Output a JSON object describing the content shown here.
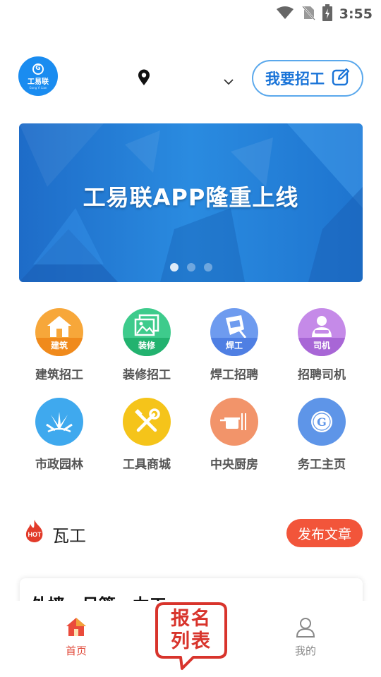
{
  "status_bar": {
    "time": "3:55"
  },
  "header": {
    "logo_text": "工易联",
    "logo_sub": "Gong Yi Lian",
    "recruit_label": "我要招工"
  },
  "banner": {
    "title": "工易联APP隆重上线",
    "slides": 3,
    "active_slide": 1
  },
  "categories": [
    {
      "label": "建筑招工",
      "badge": "建筑",
      "color": "#f7a73a",
      "badge_color": "#f08a1c",
      "icon": "house-icon"
    },
    {
      "label": "装修招工",
      "badge": "装修",
      "color": "#3ecb8c",
      "badge_color": "#22b26f",
      "icon": "pictures-icon"
    },
    {
      "label": "焊工招聘",
      "badge": "焊工",
      "color": "#6e9bef",
      "badge_color": "#4f7fe3",
      "icon": "welding-mask-icon"
    },
    {
      "label": "招聘司机",
      "badge": "司机",
      "color": "#c58ae8",
      "badge_color": "#a866d6",
      "icon": "driver-icon"
    },
    {
      "label": "市政园林",
      "badge": "",
      "color": "#3fa9ee",
      "badge_color": "",
      "icon": "plant-icon"
    },
    {
      "label": "工具商城",
      "badge": "",
      "color": "#f5c41a",
      "badge_color": "",
      "icon": "tools-icon"
    },
    {
      "label": "中央厨房",
      "badge": "",
      "color": "#f2946a",
      "badge_color": "",
      "icon": "pot-icon"
    },
    {
      "label": "务工主页",
      "badge": "",
      "color": "#5e95e8",
      "badge_color": "",
      "icon": "g-logo-icon"
    }
  ],
  "section": {
    "hot_label": "HOT",
    "title": "瓦工",
    "publish_label": "发布文章"
  },
  "article": {
    "title": "外墙、吊篮、力工"
  },
  "bottom_nav": {
    "home_label": "首页",
    "signup_label_line1": "报名",
    "signup_label_line2": "列表",
    "me_label": "我的"
  },
  "colors": {
    "accent_blue": "#1a74d8",
    "accent_red": "#f2553a",
    "home_active": "#e04a3a"
  }
}
